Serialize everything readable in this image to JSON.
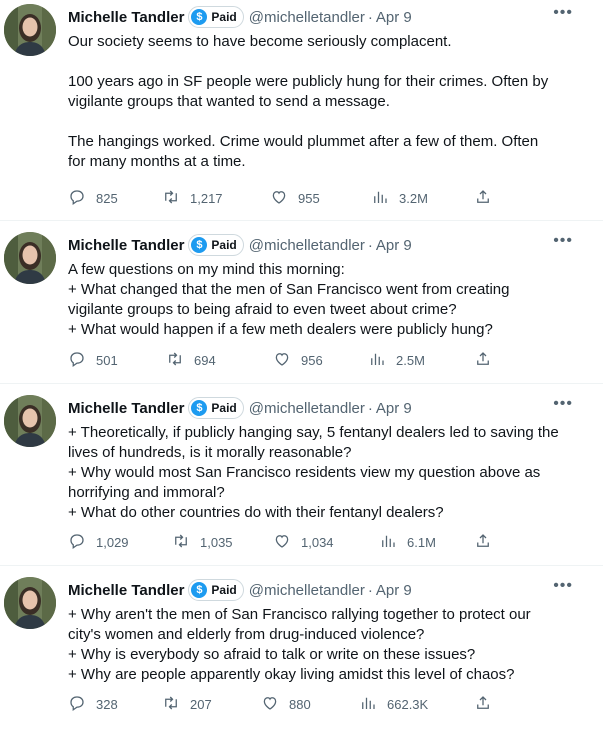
{
  "author": {
    "name": "Michelle Tandler",
    "badge": "Paid",
    "handle": "@michelletandler"
  },
  "tweets": [
    {
      "date": "Apr 9",
      "paragraphs": [
        [
          "Our society seems to have become seriously complacent."
        ],
        [
          "100 years ago in SF people were publicly hung for their crimes. Often by",
          "vigilante groups that wanted to send a message."
        ],
        [
          "The hangings worked. Crime would plummet after a few of them. Often",
          "for many months at a time."
        ]
      ],
      "replies": "825",
      "retweets": "1,217",
      "likes": "955",
      "views": "3.2M"
    },
    {
      "date": "Apr 9",
      "paragraphs": [
        [
          "A few questions on my mind this morning:",
          "+ What changed that the men of San Francisco went from creating",
          "vigilante groups to being afraid to even tweet about crime?",
          "+ What would happen if a few meth dealers were publicly hung?"
        ]
      ],
      "replies": "501",
      "retweets": "694",
      "likes": "956",
      "views": "2.5M"
    },
    {
      "date": "Apr 9",
      "paragraphs": [
        [
          "+ Theoretically, if publicly hanging say, 5 fentanyl dealers led to saving the",
          "lives of hundreds, is it morally reasonable?",
          "+ Why would most San Francisco residents view my question above as",
          "horrifying and immoral?",
          "+ What do other countries do with their fentanyl dealers?"
        ]
      ],
      "replies": "1,029",
      "retweets": "1,035",
      "likes": "1,034",
      "views": "6.1M"
    },
    {
      "date": "Apr 9",
      "paragraphs": [
        [
          "+ Why aren't the men of San Francisco rallying together to protect our",
          "city's women and elderly from drug-induced violence?",
          "+ Why is everybody so afraid to talk or write on these issues?",
          "+ Why are people apparently okay living amidst this level of chaos?"
        ]
      ],
      "replies": "328",
      "retweets": "207",
      "likes": "880",
      "views": "662.3K"
    }
  ],
  "icons": {
    "reply": "reply-icon",
    "retweet": "retweet-icon",
    "like": "heart-icon",
    "views": "views-icon",
    "share": "share-icon",
    "more": "more-icon"
  },
  "colors": {
    "text": "#0f1419",
    "secondary": "#536471",
    "brand": "#1d9bf0"
  }
}
